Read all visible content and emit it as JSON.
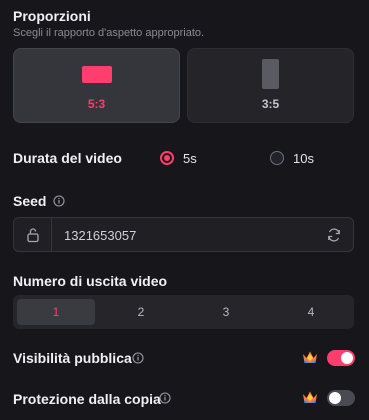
{
  "proporzioni": {
    "title": "Proporzioni",
    "subtitle": "Scegli il rapporto d'aspetto appropriato.",
    "options": [
      {
        "label": "5:3",
        "selected": true
      },
      {
        "label": "3:5",
        "selected": false
      }
    ]
  },
  "durata": {
    "label": "Durata del video",
    "options": [
      {
        "label": "5s",
        "selected": true
      },
      {
        "label": "10s",
        "selected": false
      }
    ]
  },
  "seed": {
    "label": "Seed",
    "value": "1321653057"
  },
  "numero": {
    "label": "Numero di uscita video",
    "options": [
      "1",
      "2",
      "3",
      "4"
    ],
    "selected": "1"
  },
  "visibilita": {
    "label": "Visibilità pubblica",
    "enabled": true
  },
  "protezione": {
    "label": "Protezione dalla copia",
    "enabled": false
  },
  "colors": {
    "accent": "#ff3e6e",
    "background": "#17171b"
  }
}
